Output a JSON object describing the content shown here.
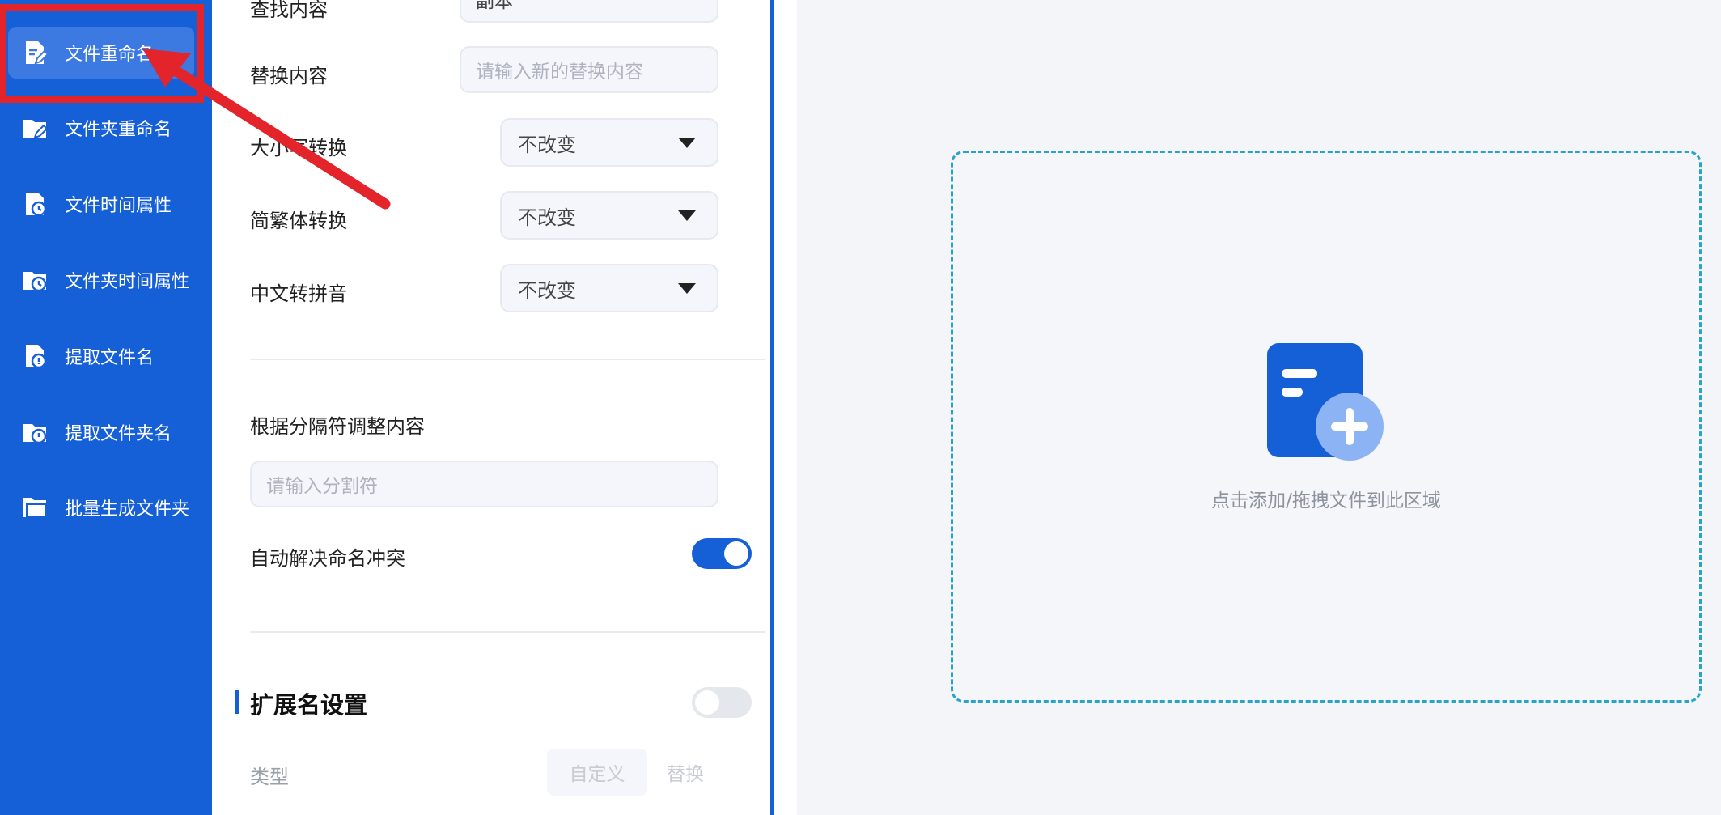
{
  "sidebar": {
    "items": [
      {
        "label": "文件重命名",
        "icon": "file-rename-icon",
        "active": true
      },
      {
        "label": "文件夹重命名",
        "icon": "folder-rename-icon",
        "active": false
      },
      {
        "label": "文件时间属性",
        "icon": "file-time-icon",
        "active": false
      },
      {
        "label": "文件夹时间属性",
        "icon": "folder-time-icon",
        "active": false
      },
      {
        "label": "提取文件名",
        "icon": "file-extract-icon",
        "active": false
      },
      {
        "label": "提取文件夹名",
        "icon": "folder-extract-icon",
        "active": false
      },
      {
        "label": "批量生成文件夹",
        "icon": "folder-generate-icon",
        "active": false
      }
    ]
  },
  "panel": {
    "find": {
      "label": "查找内容",
      "value": "副本"
    },
    "replace": {
      "label": "替换内容",
      "placeholder": "请输入新的替换内容"
    },
    "case_convert": {
      "label": "大小写转换",
      "value": "不改变"
    },
    "trad_simp": {
      "label": "简繁体转换",
      "value": "不改变"
    },
    "pinyin": {
      "label": "中文转拼音",
      "value": "不改变"
    },
    "separator": {
      "label": "根据分隔符调整内容",
      "placeholder": "请输入分割符"
    },
    "auto_resolve": {
      "label": "自动解决命名冲突",
      "enabled": true
    },
    "extension": {
      "title": "扩展名设置",
      "enabled": false
    },
    "type": {
      "label": "类型",
      "options": [
        "自定义",
        "替换"
      ]
    }
  },
  "dropzone": {
    "text": "点击添加/拖拽文件到此区域"
  },
  "colors": {
    "brand": "#155fd7",
    "annotation": "#e3242b",
    "dashed_border": "#2aa3c9"
  }
}
